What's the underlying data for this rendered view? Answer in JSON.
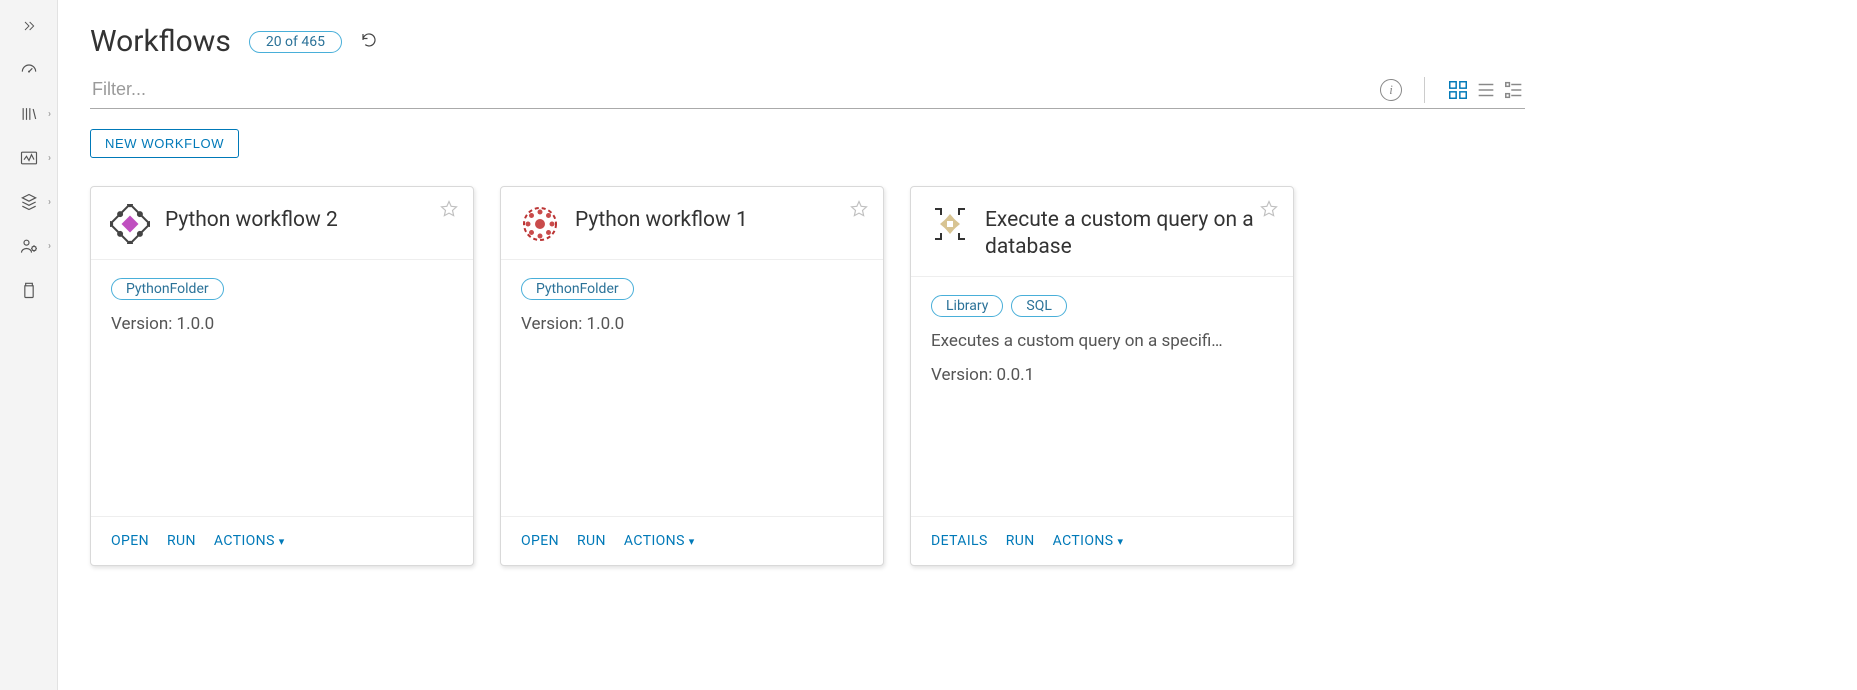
{
  "page": {
    "title": "Workflows",
    "count_label": "20 of 465",
    "filter_placeholder": "Filter...",
    "new_button": "NEW WORKFLOW"
  },
  "cards": [
    {
      "title": "Python workflow 2",
      "tags": [
        "PythonFolder"
      ],
      "description": "",
      "version": "Version: 1.0.0",
      "actions": {
        "primary": "OPEN",
        "run": "RUN",
        "menu": "ACTIONS"
      },
      "icon_variant": "magenta"
    },
    {
      "title": "Python workflow 1",
      "tags": [
        "PythonFolder"
      ],
      "description": "",
      "version": "Version: 1.0.0",
      "actions": {
        "primary": "OPEN",
        "run": "RUN",
        "menu": "ACTIONS"
      },
      "icon_variant": "red"
    },
    {
      "title": "Execute a custom query on a database",
      "tags": [
        "Library",
        "SQL"
      ],
      "description": "Executes a custom query on a specifi…",
      "version": "Version: 0.0.1",
      "actions": {
        "primary": "DETAILS",
        "run": "RUN",
        "menu": "ACTIONS"
      },
      "icon_variant": "tan"
    }
  ]
}
